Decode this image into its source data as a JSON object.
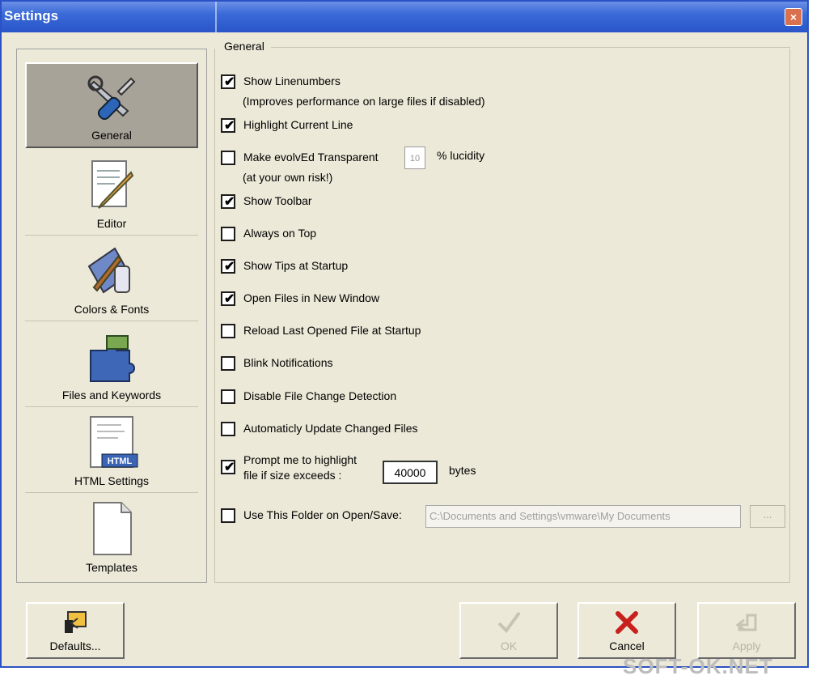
{
  "window": {
    "title": "Settings",
    "close_label": "×"
  },
  "sidebar": {
    "items": [
      {
        "label": "General",
        "icon": "tools-icon",
        "selected": true
      },
      {
        "label": "Editor",
        "icon": "editor-icon",
        "selected": false
      },
      {
        "label": "Colors & Fonts",
        "icon": "paint-icon",
        "selected": false
      },
      {
        "label": "Files and Keywords",
        "icon": "puzzle-icon",
        "selected": false
      },
      {
        "label": "HTML Settings",
        "icon": "html-file-icon",
        "selected": false
      },
      {
        "label": "Templates",
        "icon": "template-icon",
        "selected": false
      }
    ]
  },
  "general": {
    "title": "General",
    "options": [
      {
        "label": "Show Linenumbers",
        "checked": true
      },
      {
        "label": "Highlight Current Line",
        "checked": true
      },
      {
        "label": "Make evolvEd Transparent",
        "checked": false
      },
      {
        "label": "Show Toolbar",
        "checked": true
      },
      {
        "label": "Always on Top",
        "checked": false
      },
      {
        "label": "Show Tips at Startup",
        "checked": true
      },
      {
        "label": "Open Files in New Window",
        "checked": true
      },
      {
        "label": "Reload Last Opened File at Startup",
        "checked": false
      },
      {
        "label": "Blink Notifications",
        "checked": false
      },
      {
        "label": "Disable File Change Detection",
        "checked": false
      },
      {
        "label": "Automaticly Update Changed Files",
        "checked": false
      },
      {
        "label": "Prompt me to highlight",
        "checked": true
      },
      {
        "label": "Use This Folder on Open/Save:",
        "checked": false
      }
    ],
    "linenumbers_note": "(Improves performance on large files if disabled)",
    "transparent_note": "(at your own risk!)",
    "lucidity_value": "10",
    "lucidity_label": "% lucidity",
    "prompt_line2": "file if size exceeds :",
    "size_value": "40000",
    "size_unit": "bytes",
    "folder_value": "C:\\Documents and Settings\\vmware\\My Documents",
    "browse_label": "..."
  },
  "buttons": {
    "defaults": "Defaults...",
    "ok": "OK",
    "cancel": "Cancel",
    "apply": "Apply"
  },
  "watermark": "SOFT-OK.NET"
}
